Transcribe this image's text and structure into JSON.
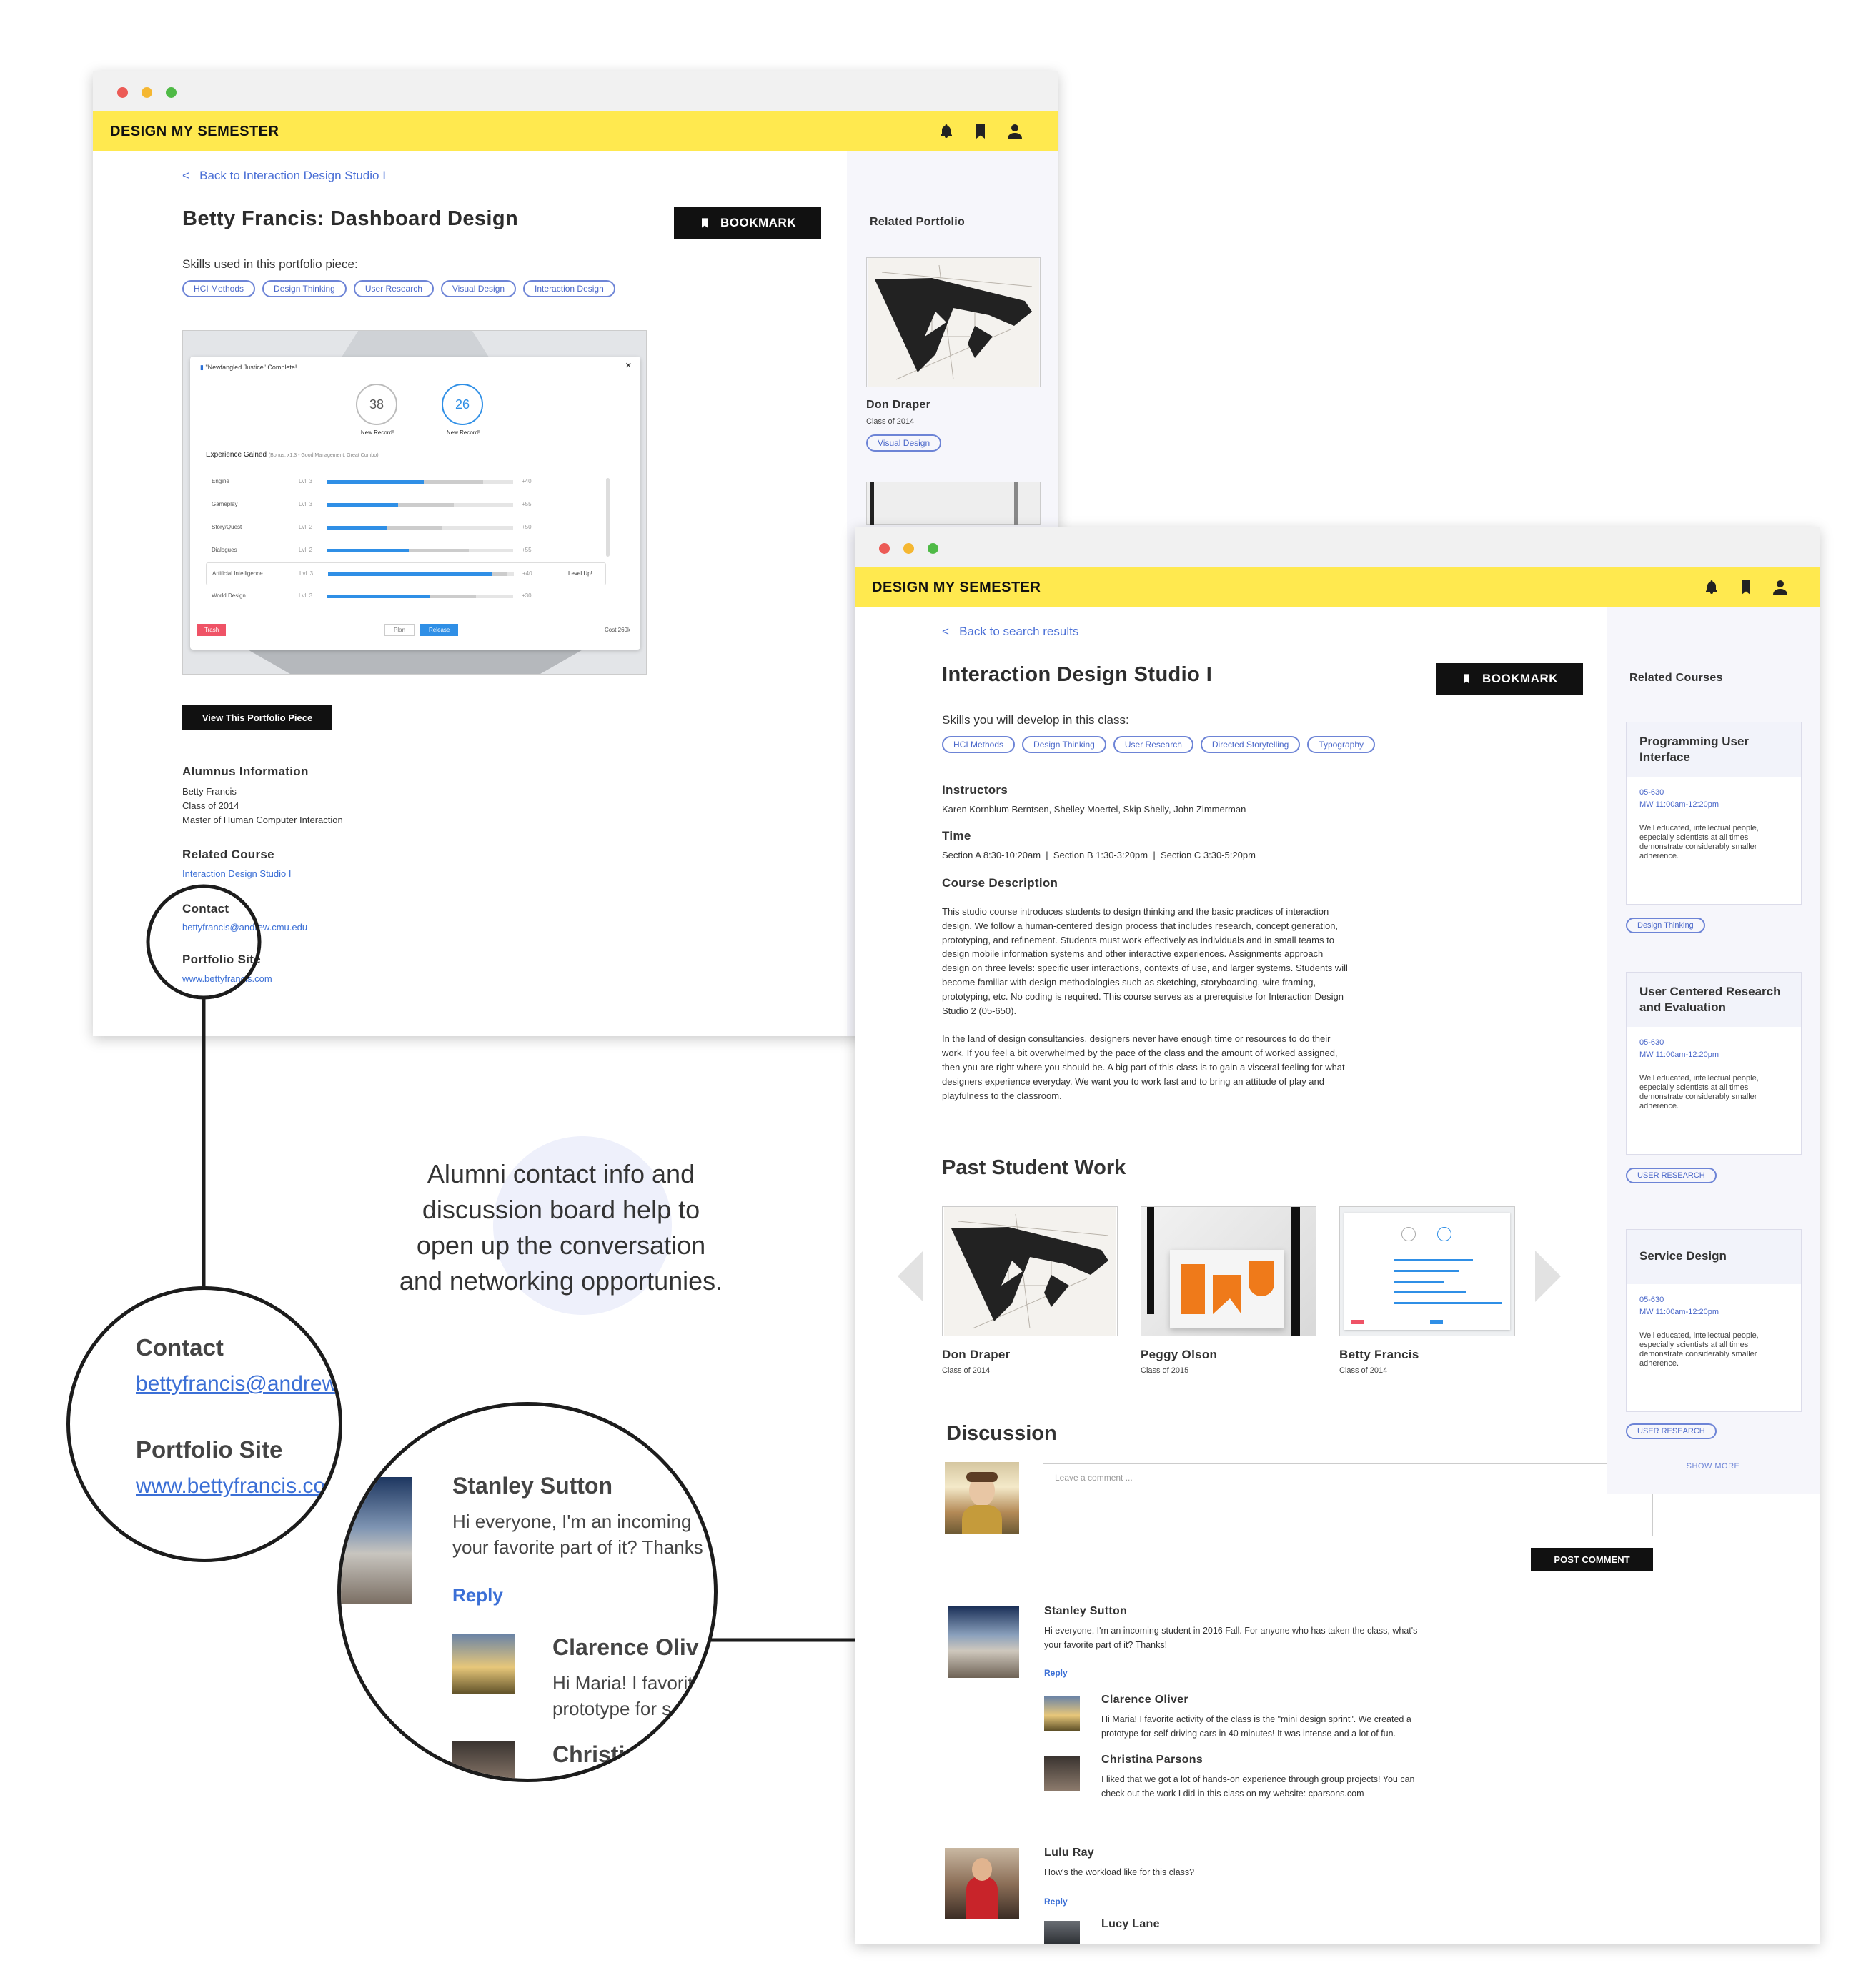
{
  "brand": "DESIGN MY SEMESTER",
  "left_window": {
    "back_link": "Back to Interaction Design Studio I",
    "title": "Betty Francis: Dashboard Design",
    "bookmark_label": "BOOKMARK",
    "skills_label": "Skills used in this portfolio piece:",
    "skills": [
      "HCI Methods",
      "Design Thinking",
      "User Research",
      "Visual Design",
      "Interaction Design"
    ],
    "mock": {
      "dialog_title": "\"Newfangled Justice\" Complete!",
      "score1": "38",
      "score2": "26",
      "record1": "New Record!",
      "record2": "New Record!",
      "exp_label": "Experience Gained",
      "exp_note": "(Bonus: x1.3 - Good Management, Great Combo)",
      "rows": [
        {
          "name": "Engine",
          "lvl": "Lvl. 3",
          "val": "+40",
          "fill": 0.52,
          "gray": 0.32
        },
        {
          "name": "Gameplay",
          "lvl": "Lvl. 3",
          "val": "+55",
          "fill": 0.38,
          "gray": 0.3
        },
        {
          "name": "Story/Quest",
          "lvl": "Lvl. 2",
          "val": "+50",
          "fill": 0.32,
          "gray": 0.3
        },
        {
          "name": "Dialogues",
          "lvl": "Lvl. 2",
          "val": "+55",
          "fill": 0.44,
          "gray": 0.32
        },
        {
          "name": "Artificial Intelligence",
          "lvl": "Lvl. 3",
          "val": "+40",
          "fill": 0.88,
          "gray": 0.08
        },
        {
          "name": "World Design",
          "lvl": "Lvl. 3",
          "val": "+30",
          "fill": 0.55,
          "gray": 0.25
        }
      ],
      "level_up": "Level Up!",
      "trash": "Trash",
      "plan": "Plan",
      "release": "Release",
      "cost": "Cost 260k"
    },
    "view_button": "View This Portfolio Piece",
    "alumnus_heading": "Alumnus Information",
    "alumnus_name": "Betty Francis",
    "alumnus_class": "Class of 2014",
    "alumnus_degree": "Master of Human Computer Interaction",
    "related_course_heading": "Related Course",
    "related_course_link": "Interaction Design Studio I",
    "contact_heading": "Contact",
    "contact_email": "bettyfrancis@andrew.cmu.edu",
    "portfolio_heading": "Portfolio Site",
    "portfolio_url": "www.bettyfrancis.com",
    "sidebar": {
      "heading": "Related Portfolio",
      "name": "Don Draper",
      "class": "Class of 2014",
      "tag": "Visual Design"
    }
  },
  "annotation": {
    "line1": "Alumni contact info and",
    "line2": "discussion board help to",
    "line3": "open up the conversation",
    "line4": "and networking opportunies."
  },
  "zoom1": {
    "contact": "Contact",
    "email": "bettyfrancis@andrew.",
    "portfolio": "Portfolio Site",
    "url": "www.bettyfrancis.co"
  },
  "zoom2": {
    "name": "Stanley Sutton",
    "line1": "Hi everyone, I'm an incoming",
    "line2": "your favorite part of it? Thanks",
    "reply": "Reply",
    "name2": "Clarence Oliv",
    "l2a": "Hi Maria! I favorit",
    "l2b": "prototype for s",
    "name3": "Christi"
  },
  "right_window": {
    "back_link": "Back to search results",
    "title": "Interaction Design Studio I",
    "bookmark_label": "BOOKMARK",
    "skills_label": "Skills you will develop in this class:",
    "skills": [
      "HCI Methods",
      "Design Thinking",
      "User Research",
      "Directed Storytelling",
      "Typography"
    ],
    "instructors_heading": "Instructors",
    "instructors": "Karen Kornblum Berntsen, Shelley Moertel, Skip Shelly, John Zimmerman",
    "time_heading": "Time",
    "time": "Section A 8:30-10:20am  |  Section B 1:30-3:20pm  |  Section C 3:30-5:20pm",
    "desc_heading": "Course Description",
    "desc_p1": [
      "This studio course introduces students to design thinking and the basic practices of interaction",
      "design. We follow a human-centered design process that includes research, concept generation,",
      "prototyping, and refinement. Students must work effectively as individuals and in small teams to",
      "design mobile information systems and other interactive experiences. Assignments approach",
      "design on three levels: specific user interactions, contexts of use, and larger systems. Students will",
      "become familiar with design methodologies such as sketching, storyboarding, wire framing,",
      "prototyping, etc. No coding is required. This course serves as a prerequisite for Interaction Design",
      "Studio 2 (05-650)."
    ],
    "desc_p2": [
      "In the land of design consultancies, designers never have enough time or resources to do their",
      "work. If you feel a bit overwhelmed by the pace of the class and the amount of worked assigned,",
      "then you are right where you should be. A big part of this class is to gain a visceral feeling for what",
      "designers experience everyday. We want you to work fast and to bring an attitude of play and",
      "playfulness to the classroom."
    ],
    "past_heading": "Past Student Work",
    "past": [
      {
        "name": "Don Draper",
        "class": "Class of 2014"
      },
      {
        "name": "Peggy Olson",
        "class": "Class of 2015"
      },
      {
        "name": "Betty Francis",
        "class": "Class of 2014"
      }
    ],
    "discussion_heading": "Discussion",
    "comment_placeholder": "Leave a comment ...",
    "post_button": "POST COMMENT",
    "comments": [
      {
        "name": "Stanley Sutton",
        "text1": "Hi everyone, I'm an incoming student in 2016 Fall. For anyone who has taken the class, what's",
        "text2": "your favorite part of it? Thanks!",
        "reply": "Reply"
      },
      {
        "name": "Clarence Oliver",
        "text1": "Hi Maria! I favorite activity of the class is the \"mini design sprint\". We created a",
        "text2": "prototype for self-driving cars in 40 minutes! It was intense and a lot of fun."
      },
      {
        "name": "Christina Parsons",
        "text1": "I liked that we got a lot of hands-on experience through group projects! You can",
        "text2": "check out the work I did in this class on my website: cparsons.com"
      },
      {
        "name": "Lulu Ray",
        "text1": "How's the workload like for this class?",
        "reply": "Reply"
      },
      {
        "name": "Lucy Lane"
      }
    ],
    "sidebar": {
      "heading": "Related Courses",
      "courses": [
        {
          "title1": "Programming User",
          "title2": "Interface",
          "code": "05-630",
          "time": "MW 11:00am-12:20pm",
          "desc": [
            "Well educated, intellectual people,",
            "especially scientists at all times",
            "demonstrate considerably smaller",
            "adherence."
          ],
          "tag": "Design Thinking"
        },
        {
          "title1": "User Centered Research",
          "title2": "and Evaluation",
          "code": "05-630",
          "time": "MW 11:00am-12:20pm",
          "desc": [
            "Well educated, intellectual people,",
            "especially scientists at all times",
            "demonstrate considerably smaller",
            "adherence."
          ],
          "tag": "USER RESEARCH"
        },
        {
          "title1": "Service Design",
          "title2": "",
          "code": "05-630",
          "time": "MW 11:00am-12:20pm",
          "desc": [
            "Well educated, intellectual people,",
            "especially scientists at all times",
            "demonstrate considerably smaller",
            "adherence."
          ],
          "tag": "USER RESEARCH"
        }
      ],
      "show_more": "SHOW MORE"
    }
  }
}
